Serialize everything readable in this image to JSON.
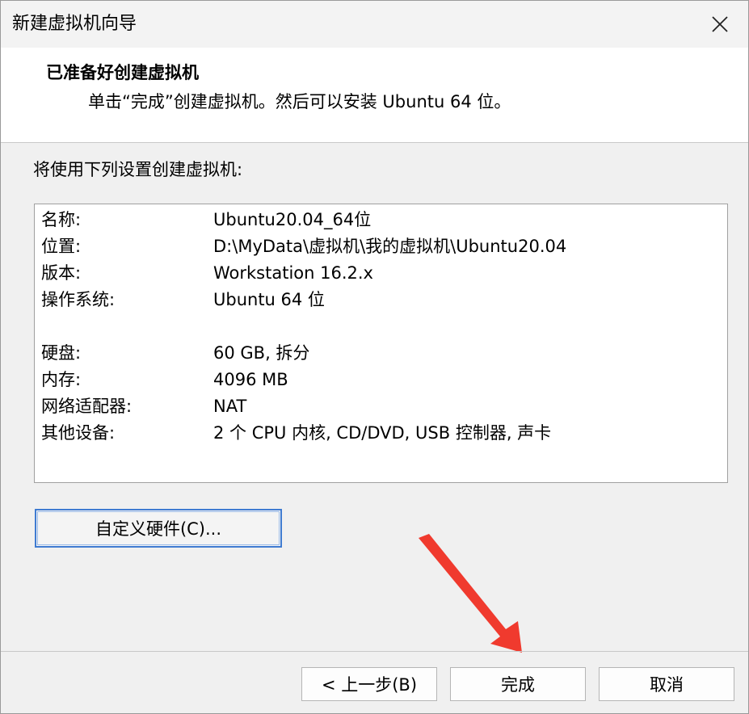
{
  "window": {
    "title": "新建虚拟机向导"
  },
  "header": {
    "title": "已准备好创建虚拟机",
    "subtitle": "单击“完成”创建虚拟机。然后可以安装 Ubuntu 64 位。"
  },
  "main": {
    "intro": "将使用下列设置创建虚拟机:",
    "summary": [
      {
        "key": "名称:",
        "value": "Ubuntu20.04_64位"
      },
      {
        "key": "位置:",
        "value": "D:\\MyData\\虚拟机\\我的虚拟机\\Ubuntu20.04"
      },
      {
        "key": "版本:",
        "value": "Workstation 16.2.x"
      },
      {
        "key": "操作系统:",
        "value": "Ubuntu 64 位"
      },
      {
        "key": "硬盘:",
        "value": "60 GB, 拆分"
      },
      {
        "key": "内存:",
        "value": "4096 MB"
      },
      {
        "key": "网络适配器:",
        "value": "NAT"
      },
      {
        "key": "其他设备:",
        "value": "2 个 CPU 内核, CD/DVD, USB 控制器, 声卡"
      }
    ],
    "customize_label": "自定义硬件(C)..."
  },
  "footer": {
    "back_label": "< 上一步(B)",
    "finish_label": "完成",
    "cancel_label": "取消"
  },
  "icons": {
    "close": "close-icon",
    "annotation_arrow": "arrow-icon"
  },
  "colors": {
    "accent_border": "#3f7bd1",
    "arrow_red": "#f03a2e"
  }
}
